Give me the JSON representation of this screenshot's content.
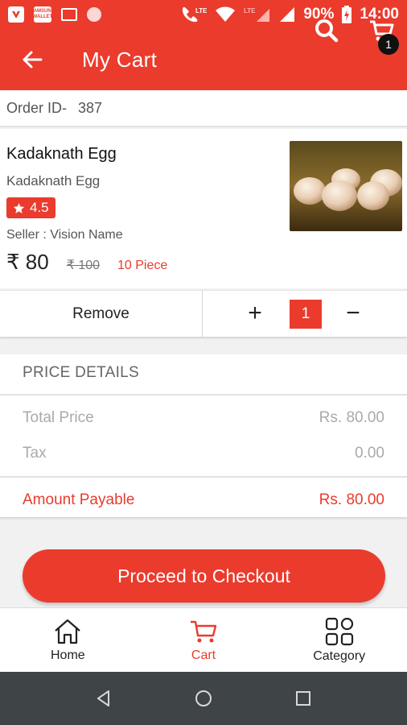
{
  "status_bar": {
    "app2_text": "SAMSUNG WALLET",
    "network": "LTE",
    "network2": "LTE",
    "battery": "90%",
    "time": "14:00"
  },
  "app_bar": {
    "title": "My Cart",
    "cart_count": "1"
  },
  "order": {
    "label": "Order ID-",
    "value": "387"
  },
  "product": {
    "name": "Kadaknath Egg",
    "subtitle": "Kadaknath Egg",
    "rating": "4.5",
    "seller": "Seller : Vision Name",
    "price": "₹ 80",
    "mrp": "₹ 100",
    "unit": "10 Piece",
    "image_icon": "eggs-photo"
  },
  "actions": {
    "remove": "Remove",
    "plus": "+",
    "quantity": "1",
    "minus": "−"
  },
  "price_details": {
    "title": "PRICE DETAILS",
    "rows": [
      {
        "label": "Total Price",
        "value": "Rs. 80.00"
      },
      {
        "label": "Tax",
        "value": "0.00"
      }
    ],
    "total_label": "Amount Payable",
    "total_value": "Rs. 80.00"
  },
  "checkout": {
    "label": "Proceed to Checkout"
  },
  "bottom_nav": {
    "items": [
      {
        "label": "Home",
        "icon": "home-icon"
      },
      {
        "label": "Cart",
        "icon": "cart-icon"
      },
      {
        "label": "Category",
        "icon": "category-icon"
      }
    ],
    "active": "Cart"
  },
  "colors": {
    "accent": "#ea3b2d",
    "nav_bar": "#3f4447"
  }
}
